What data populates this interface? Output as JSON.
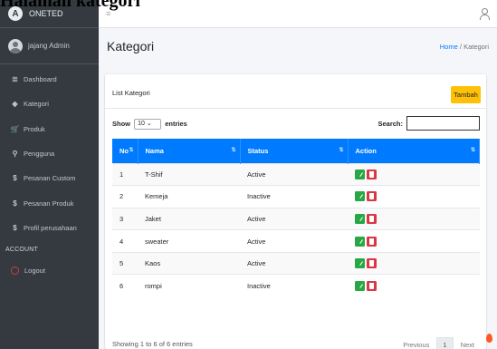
{
  "caption": "Halaman kategori",
  "brand": {
    "logo": "A",
    "name": "ONETED"
  },
  "user": {
    "name": "jajang Admin"
  },
  "nav": [
    {
      "icon": "≣",
      "label": "Dashboard"
    },
    {
      "icon": "◈",
      "label": "Kategori"
    },
    {
      "icon": "🛒",
      "label": "Produk"
    },
    {
      "icon": "⚲",
      "label": "Pengguna"
    },
    {
      "icon": "$",
      "label": "Pesanan Custom"
    },
    {
      "icon": "$",
      "label": "Pesanan Produk"
    },
    {
      "icon": "$",
      "label": "Profil perusahaan"
    }
  ],
  "nav_section": "ACCOUNT",
  "logout": "Logout",
  "topbar": {
    "menu_icon": "≡"
  },
  "page_title": "Kategori",
  "breadcrumb": {
    "home": "Home",
    "separator": "/",
    "current": "Kategori"
  },
  "card": {
    "title": "List Kategori",
    "add_button": "Tambah"
  },
  "datatable": {
    "show_label": "Show",
    "entries_value": "10",
    "entries_label": "entries",
    "search_label": "Search:",
    "columns": [
      "No",
      "Nama",
      "Status",
      "Action"
    ],
    "rows": [
      {
        "no": "1",
        "nama": "T-Shif",
        "status": "Active"
      },
      {
        "no": "2",
        "nama": "Kemeja",
        "status": "Inactive"
      },
      {
        "no": "3",
        "nama": "Jaket",
        "status": "Active"
      },
      {
        "no": "4",
        "nama": "sweater",
        "status": "Active"
      },
      {
        "no": "5",
        "nama": "Kaos",
        "status": "Active"
      },
      {
        "no": "6",
        "nama": "rompi",
        "status": "Inactive"
      }
    ],
    "info": "Showing 1 to 6 of 6 entries",
    "pagination": {
      "previous": "Previous",
      "page": "1",
      "next": "Next"
    }
  },
  "colors": {
    "sidebar": "#343a40",
    "primary": "#007bff",
    "warning": "#ffc107",
    "success": "#28a745",
    "danger": "#dc3545"
  }
}
